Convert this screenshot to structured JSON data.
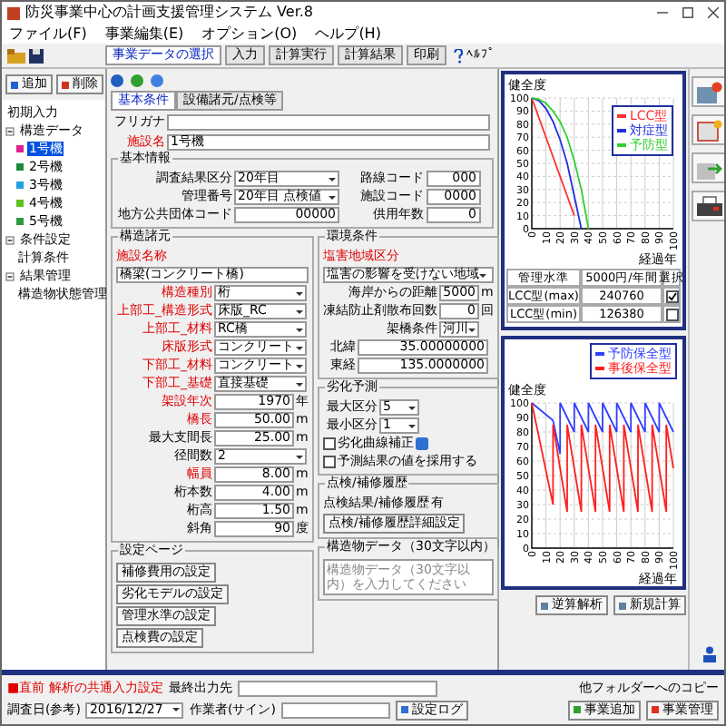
{
  "window": {
    "title": "防災事業中心の計画支援管理システム Ver.8"
  },
  "menu": [
    "ファイル(F)",
    "事業編集(E)",
    "オプション(O)",
    "ヘルプ(H)"
  ],
  "toolbar": {
    "tabs": [
      {
        "label": "事業データの選択",
        "selected": true
      },
      {
        "label": "入力",
        "selected": false
      },
      {
        "label": "計算実行",
        "selected": false
      },
      {
        "label": "計算結果",
        "selected": false
      },
      {
        "label": "印刷",
        "selected": false
      }
    ],
    "help": "ﾍﾙﾌﾟ"
  },
  "sidebar": {
    "buttons": [
      "追加",
      "削除"
    ],
    "tree": [
      {
        "label": "初期入力",
        "selected": false
      },
      {
        "label": "構造データ",
        "selected": false,
        "children": [
          {
            "label": "1号機",
            "color": "#e0208c",
            "selected": true
          },
          {
            "label": "2号機",
            "color": "#1a8a3a",
            "selected": false
          },
          {
            "label": "3号機",
            "color": "#20a0e0",
            "selected": false
          },
          {
            "label": "4号機",
            "color": "#60c020",
            "selected": false
          },
          {
            "label": "5号機",
            "color": "#2a9a40",
            "selected": false
          }
        ]
      },
      {
        "label": "条件設定",
        "selected": false,
        "children": [
          {
            "label": "計算条件",
            "selected": false
          }
        ]
      },
      {
        "label": "結果管理",
        "selected": false,
        "children": [
          {
            "label": "構造物状態管理",
            "selected": false
          }
        ]
      }
    ]
  },
  "form": {
    "tabs": [
      {
        "label": "基本条件",
        "selected": true
      },
      {
        "label": "設備諸元/点検等",
        "selected": false
      }
    ],
    "header": [
      {
        "label": "フリガナ",
        "required": false
      },
      {
        "label": "施設名",
        "value": "1号機",
        "required": true
      }
    ],
    "basic": {
      "title": "基本情報",
      "fields": [
        {
          "label": "調査結果区分",
          "value": "20年目",
          "kind": "select"
        },
        {
          "label": "路線コード",
          "value": "000",
          "kind": "input"
        },
        {
          "label": "管理番号",
          "value": "20年目 点検値",
          "kind": "select"
        },
        {
          "label": "施設コード",
          "value": "0000",
          "kind": "input"
        },
        {
          "label": "地方公共団体コード",
          "value": "00000",
          "kind": "input"
        },
        {
          "label": "供用年数",
          "value": "0",
          "kind": "input"
        }
      ]
    },
    "structure": {
      "title": "構造諸元",
      "fields": [
        {
          "label": "施設名称",
          "value": "橋梁(コンクリート橋)",
          "kind": "input",
          "required": true
        },
        {
          "label": "構造種別",
          "value": "桁",
          "kind": "select",
          "required": true
        },
        {
          "label": "上部工_構造形式",
          "value": "床版_RC",
          "kind": "select",
          "required": true
        },
        {
          "label": "上部工_材料",
          "value": "RC橋",
          "kind": "select",
          "required": true
        },
        {
          "label": "床版形式",
          "value": "コンクリート",
          "kind": "select",
          "required": true
        },
        {
          "label": "下部工_材料",
          "value": "コンクリート",
          "kind": "select",
          "required": true
        },
        {
          "label": "下部工_基礎",
          "value": "直接基礎",
          "kind": "select",
          "required": true
        },
        {
          "label": "架設年次",
          "value": "1970",
          "unit": "年",
          "kind": "input",
          "required": true
        },
        {
          "label": "橋長",
          "value": "50.00",
          "unit": "m",
          "kind": "input",
          "required": true
        },
        {
          "label": "最大支間長",
          "value": "25.00",
          "unit": "m",
          "kind": "input",
          "required": false
        },
        {
          "label": "径間数",
          "value": "2",
          "kind": "select",
          "required": false
        },
        {
          "label": "幅員",
          "value": "8.00",
          "unit": "m",
          "kind": "input",
          "required": true
        },
        {
          "label": "桁本数",
          "value": "4.00",
          "unit": "m",
          "kind": "input",
          "required": false
        },
        {
          "label": "桁高",
          "value": "1.50",
          "unit": "m",
          "kind": "input",
          "required": false
        },
        {
          "label": "斜角",
          "value": "90",
          "unit": "度",
          "kind": "input",
          "required": false
        }
      ]
    },
    "environment": {
      "title": "環境条件",
      "fields": [
        {
          "label": "塩害地域区分",
          "value": "塩害の影響を受けない地域",
          "kind": "select",
          "required": true
        },
        {
          "label": "海岸からの距離",
          "value": "5000",
          "unit": "m",
          "kind": "input",
          "required": false
        },
        {
          "label": "凍結防止剤散布回数",
          "value": "0",
          "unit": "回",
          "kind": "input",
          "required": false
        },
        {
          "label": "架橋条件",
          "value": "河川",
          "kind": "select",
          "required": false
        },
        {
          "label": "北緯",
          "value": "35.00000000",
          "kind": "input",
          "required": false
        },
        {
          "label": "東経",
          "value": "135.0000000",
          "kind": "input",
          "required": false
        }
      ]
    },
    "prediction": {
      "title": "劣化予測",
      "fields": [
        {
          "label": "最大区分",
          "value": "5"
        },
        {
          "label": "最小区分",
          "value": "1"
        }
      ],
      "checks": [
        {
          "label": "劣化曲線補正",
          "checked": false
        },
        {
          "label": "予測結果の値を採用する",
          "checked": false
        }
      ]
    },
    "inspection": {
      "title": "点検/補修履歴",
      "label": "点検結果/補修履歴",
      "value": "有",
      "button": "点検/補修履歴詳細設定"
    },
    "comment": {
      "title": "構造物データ（30文字以内）",
      "text": "構造物データ（30文字以内）を入力してください"
    },
    "settings": {
      "title": "設定ページ",
      "buttons": [
        "補修費用の設定",
        "劣化モデルの設定",
        "管理水準の設定",
        "点検費の設定"
      ]
    }
  },
  "chart_top": {
    "chart_data": {
      "type": "line",
      "ylabel": "健全度",
      "xlabel": "経過年",
      "grid": true,
      "legend": "right",
      "xlim": [
        0,
        100
      ],
      "ylim": [
        0,
        100
      ],
      "xticks": [
        0,
        10,
        20,
        30,
        40,
        50,
        60,
        70,
        80,
        90,
        100
      ],
      "yticks": [
        0,
        10,
        20,
        30,
        40,
        50,
        60,
        70,
        80,
        90,
        100
      ],
      "x": [
        0,
        5,
        10,
        15,
        20,
        25,
        30,
        35,
        40
      ],
      "series": [
        {
          "name": "LCC型",
          "color": "#ff3030",
          "values": [
            100,
            85,
            70,
            55,
            40,
            25,
            10,
            null,
            null
          ]
        },
        {
          "name": "対症型",
          "color": "#2030e0",
          "values": [
            100,
            98,
            92,
            82,
            68,
            50,
            25,
            0,
            null
          ]
        },
        {
          "name": "予防型",
          "color": "#30d030",
          "values": [
            100,
            99,
            96,
            90,
            82,
            70,
            52,
            30,
            0
          ]
        }
      ]
    }
  },
  "cost_table": {
    "columns": [
      "管理水準",
      "5000円/年間",
      "選択"
    ],
    "rows": [
      {
        "cells": [
          "LCC型(max)",
          "240760"
        ],
        "checked": true
      },
      {
        "cells": [
          "LCC型(min)",
          "126380"
        ],
        "checked": false
      }
    ]
  },
  "chart_bottom": {
    "chart_data": {
      "type": "line",
      "ylabel": "健全度",
      "xlabel": "経過年",
      "grid": true,
      "legend": "top",
      "xlim": [
        0,
        100
      ],
      "ylim": [
        0,
        100
      ],
      "xticks": [
        0,
        10,
        20,
        30,
        40,
        50,
        60,
        70,
        80,
        90,
        100
      ],
      "yticks": [
        0,
        10,
        20,
        30,
        40,
        50,
        60,
        70,
        80,
        90,
        100
      ],
      "x": [
        0,
        15,
        15,
        20,
        20,
        25,
        25,
        30,
        30,
        35,
        35,
        40,
        40,
        45,
        45,
        50,
        50,
        55,
        55,
        60,
        60,
        65,
        65,
        70,
        70,
        75,
        75,
        80,
        80,
        85,
        85,
        90,
        90,
        95,
        95,
        100
      ],
      "series": [
        {
          "name": "予防保全型",
          "color": "#3040ff",
          "values": [
            100,
            88,
            88,
            65,
            100,
            90,
            90,
            80,
            100,
            90,
            90,
            80,
            100,
            90,
            90,
            80,
            100,
            90,
            90,
            80,
            100,
            90,
            90,
            80,
            100,
            90,
            90,
            80,
            100,
            90,
            90,
            80,
            100,
            90,
            90,
            80
          ]
        },
        {
          "name": "事後保全型",
          "color": "#ff2020",
          "values": [
            100,
            30,
            85,
            55,
            55,
            25,
            85,
            55,
            55,
            25,
            85,
            55,
            55,
            25,
            85,
            55,
            55,
            25,
            85,
            55,
            55,
            25,
            85,
            55,
            55,
            25,
            85,
            55,
            55,
            25,
            85,
            55,
            55,
            25,
            85,
            55
          ]
        }
      ]
    }
  },
  "right_tools": {
    "buttons": [
      "逆算解析",
      "新規計算"
    ]
  },
  "bottom": {
    "notice": "■直前 解析の共通入力設定",
    "output_label": "最終出力先",
    "date_label": "調査日(参考)",
    "date_value": "2016/12/27",
    "worker_label": "作業者(サイン)",
    "log_button": "設定ログ",
    "copy_title": "他フォルダーへのコピー",
    "copy_buttons": [
      "事業追加",
      "事業管理"
    ]
  }
}
